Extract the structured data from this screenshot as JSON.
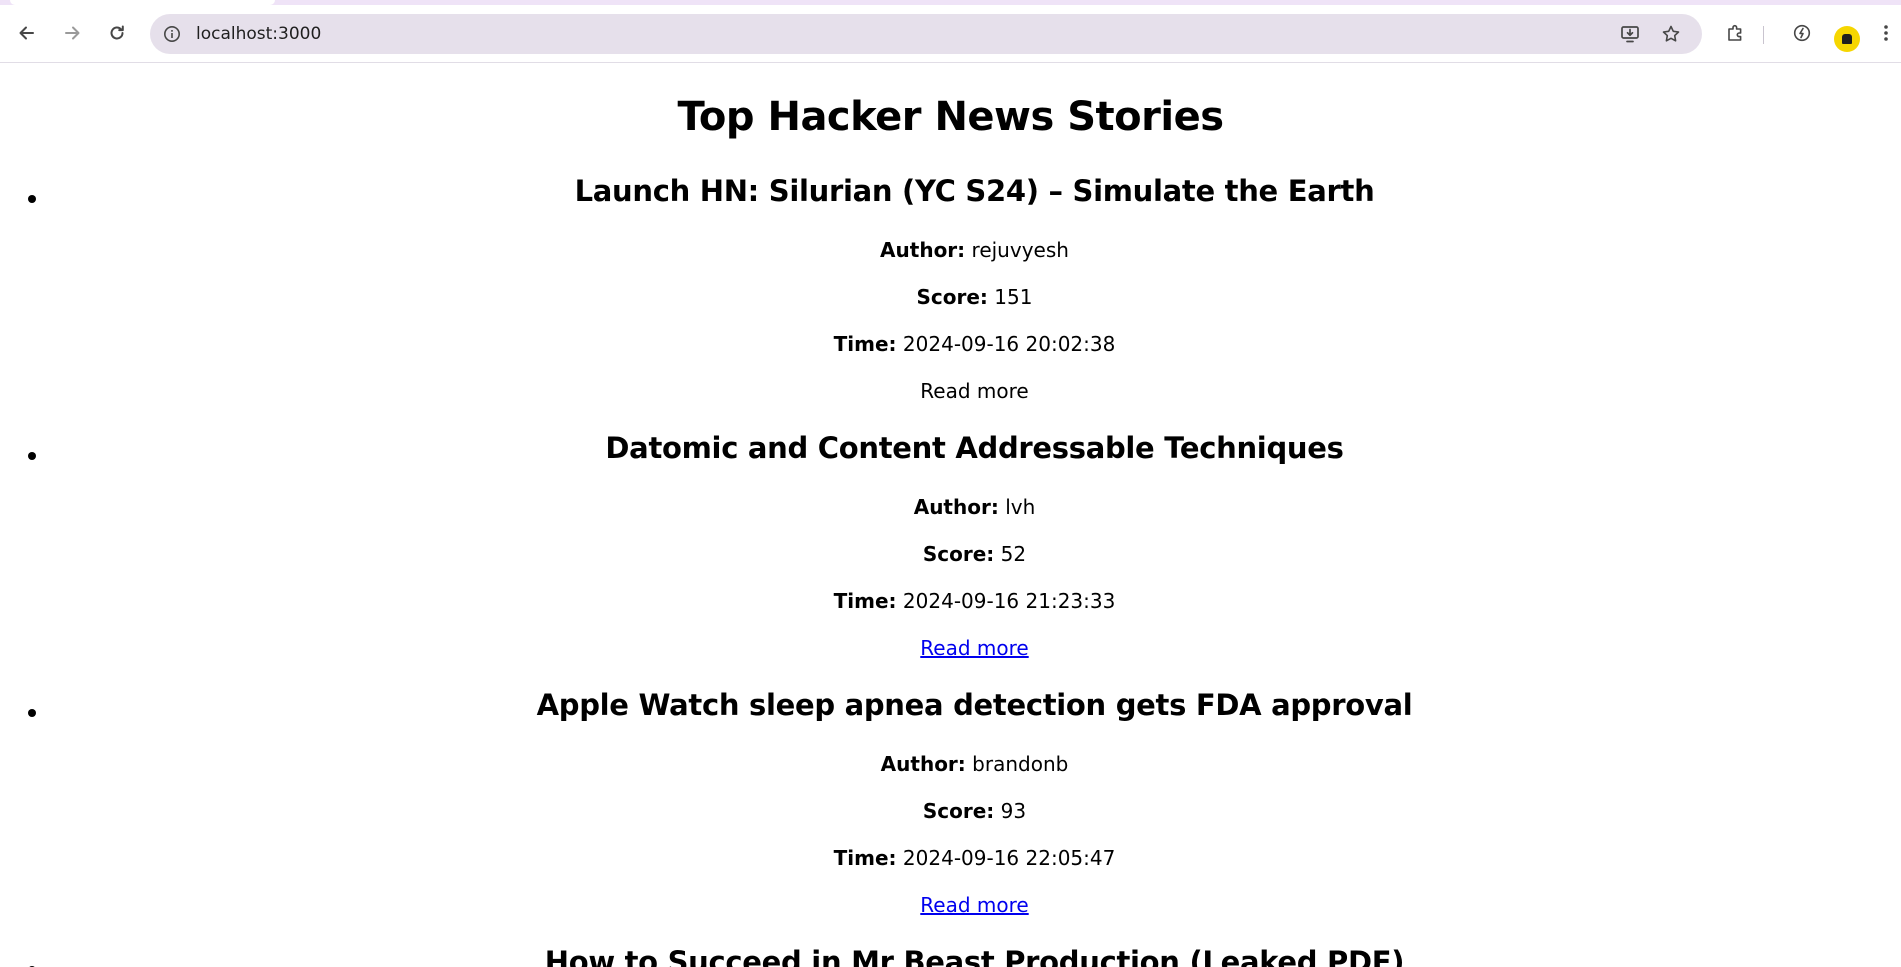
{
  "browser": {
    "url": "localhost:3000",
    "accent_color": "#efe3f7",
    "omnibox_color": "#e6e0eb",
    "profile_color": "#f6d600"
  },
  "page": {
    "title": "Top Hacker News Stories",
    "labels": {
      "author": "Author:",
      "score": "Score:",
      "time": "Time:"
    },
    "stories": [
      {
        "title": "Launch HN: Silurian (YC S24) – Simulate the Earth",
        "author": "rejuvyesh",
        "score": "151",
        "time": "2024-09-16 20:02:38",
        "link_text": "Read more",
        "is_link": false
      },
      {
        "title": "Datomic and Content Addressable Techniques",
        "author": "lvh",
        "score": "52",
        "time": "2024-09-16 21:23:33",
        "link_text": "Read more",
        "is_link": true
      },
      {
        "title": "Apple Watch sleep apnea detection gets FDA approval",
        "author": "brandonb",
        "score": "93",
        "time": "2024-09-16 22:05:47",
        "link_text": "Read more",
        "is_link": true
      },
      {
        "title": "How to Succeed in Mr Beast Production (Leaked PDF)"
      }
    ],
    "link_color": "#0000ee"
  }
}
